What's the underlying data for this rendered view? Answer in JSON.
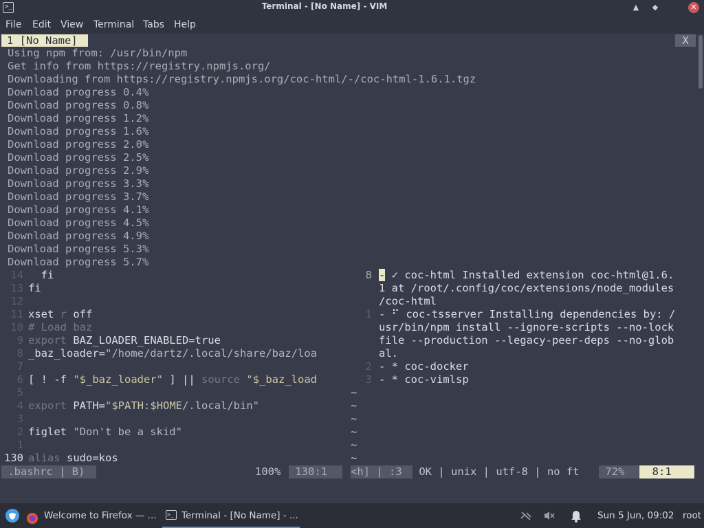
{
  "window": {
    "title": "Terminal - [No Name] - VIM",
    "minimize_glyph": "▲",
    "maximize_glyph": "◆",
    "close_glyph": "✕"
  },
  "menu": [
    "File",
    "Edit",
    "View",
    "Terminal",
    "Tabs",
    "Help"
  ],
  "tabline": {
    "tab_label": "1 [No Name]",
    "close_label": "X"
  },
  "output_lines": [
    "Using npm from: /usr/bin/npm",
    "Get info from https://registry.npmjs.org/",
    "Downloading from https://registry.npmjs.org/coc-html/-/coc-html-1.6.1.tgz",
    "Download progress 0.4%",
    "Download progress 0.8%",
    "Download progress 1.2%",
    "Download progress 1.6%",
    "Download progress 2.0%",
    "Download progress 2.5%",
    "Download progress 2.9%",
    "Download progress 3.3%",
    "Download progress 3.7%",
    "Download progress 4.1%",
    "Download progress 4.5%",
    "Download progress 4.9%",
    "Download progress 5.3%",
    "Download progress 5.7%"
  ],
  "left_pane": {
    "rows": [
      {
        "num": "14",
        "text": "  fi"
      },
      {
        "num": "13",
        "text": "fi"
      },
      {
        "num": "12",
        "text": ""
      },
      {
        "num": "11",
        "text": "xset r off"
      },
      {
        "num": "10",
        "text": "# Load baz"
      },
      {
        "num": "9",
        "text": "export BAZ_LOADER_ENABLED=true"
      },
      {
        "num": "8",
        "text": "_baz_loader=\"/home/dartz/.local/share/baz/loa"
      },
      {
        "num": "7",
        "text": ""
      },
      {
        "num": "6",
        "text": "[ ! -f \"$_baz_loader\" ] || source \"$_baz_load"
      },
      {
        "num": "5",
        "text": ""
      },
      {
        "num": "4",
        "text": "export PATH=\"$PATH:$HOME/.local/bin\""
      },
      {
        "num": "3",
        "text": ""
      },
      {
        "num": "2",
        "text": "figlet \"Don't be a skid\""
      },
      {
        "num": "1",
        "text": ""
      },
      {
        "num": "130",
        "text": "alias sudo=kos"
      }
    ]
  },
  "right_pane": {
    "rows": [
      {
        "num": "8",
        "text": "- ✓ coc-html Installed extension coc-html@1.6."
      },
      {
        "num": "",
        "text": "1 at /root/.config/coc/extensions/node_modules"
      },
      {
        "num": "",
        "text": "/coc-html"
      },
      {
        "num": "1",
        "text": "- ⠋ coc-tsserver Installing dependencies by: /"
      },
      {
        "num": "",
        "text": "usr/bin/npm install --ignore-scripts --no-lock"
      },
      {
        "num": "",
        "text": "file --production --legacy-peer-deps --no-glob"
      },
      {
        "num": "",
        "text": "al."
      },
      {
        "num": "2",
        "text": "- * coc-docker"
      },
      {
        "num": "3",
        "text": "- * coc-vimlsp"
      },
      {
        "num": "~",
        "text": ""
      },
      {
        "num": "~",
        "text": ""
      },
      {
        "num": "~",
        "text": ""
      },
      {
        "num": "~",
        "text": ""
      },
      {
        "num": "~",
        "text": ""
      },
      {
        "num": "~",
        "text": ""
      }
    ]
  },
  "statusline": {
    "left_file": " .bashrc | B) ",
    "left_percent": "100%",
    "left_pos": " 130:1 ",
    "right_mode": "<h] | :3 ",
    "right_info": " OK | unix | utf-8 | no ft ",
    "right_percent": " 72% ",
    "right_pos": "  8:1  "
  },
  "taskbar": {
    "firefox_label": "Welcome to Firefox — ...",
    "terminal_label": "Terminal - [No Name] - ...",
    "clock": "Sun  5 Jun, 09:02",
    "user": "root"
  }
}
